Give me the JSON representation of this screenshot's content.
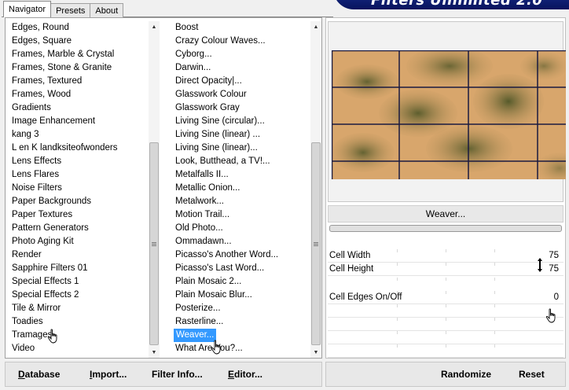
{
  "tabs": [
    {
      "label": "Navigator",
      "active": true
    },
    {
      "label": "Presets",
      "active": false
    },
    {
      "label": "About",
      "active": false
    }
  ],
  "banner": {
    "title": "Filters Unlimited 2.0"
  },
  "categories": [
    "Edges, Round",
    "Edges, Square",
    "Frames, Marble & Crystal",
    "Frames, Stone & Granite",
    "Frames, Textured",
    "Frames, Wood",
    "Gradients",
    "Image Enhancement",
    "kang 3",
    "L en K landksiteofwonders",
    "Lens Effects",
    "Lens Flares",
    "Noise Filters",
    "Paper Backgrounds",
    "Paper Textures",
    "Pattern Generators",
    "Photo Aging Kit",
    "Render",
    "Sapphire Filters 01",
    "Special Effects 1",
    "Special Effects 2",
    "Tile & Mirror",
    "Toadies",
    "Tramages",
    "Video"
  ],
  "filters": [
    "Boost",
    "Crazy Colour Waves...",
    "Cyborg...",
    "Darwin...",
    "Direct Opacity|...",
    "Glasswork Colour",
    "Glasswork Gray",
    "Living Sine (circular)...",
    "Living Sine (linear) ...",
    "Living Sine (linear)...",
    "Look, Butthead, a TV!...",
    "Metalfalls II...",
    "Metallic Onion...",
    "Metalwork...",
    "Motion Trail...",
    "Old Photo...",
    "Ommadawn...",
    "Picasso's Another Word...",
    "Picasso's Last Word...",
    "Plain Mosaic 2...",
    "Plain Mosaic Blur...",
    "Posterize...",
    "Rasterline...",
    "Weaver...",
    "What Are You?..."
  ],
  "selected_filter": "Weaver...",
  "filter_title": "Weaver...",
  "params": [
    {
      "label": "Cell Width",
      "value": "75"
    },
    {
      "label": "Cell Height",
      "value": "75"
    },
    {
      "label": "Cell Edges On/Off",
      "value": "0"
    }
  ],
  "buttons_left": [
    {
      "label": "Database",
      "underline": "D",
      "rest": "atabase"
    },
    {
      "label": "Import...",
      "underline": "I",
      "rest": "mport..."
    },
    {
      "label": "Filter Info...",
      "underline": "",
      "rest": "Filter Info..."
    },
    {
      "label": "Editor...",
      "underline": "E",
      "rest": "ditor..."
    }
  ],
  "buttons_right": [
    {
      "label": "Randomize"
    },
    {
      "label": "Reset"
    }
  ],
  "colors": {
    "selection": "#3399ff",
    "banner": "#0b1a6e",
    "tile_light": "#d8a66c",
    "tile_dark": "#4f5627",
    "tile_border": "#1a1a40"
  },
  "icons": {
    "cursor": "hand-pointer-icon",
    "link": "link-arrows-icon",
    "scroll_up": "triangle-up-icon",
    "scroll_down": "triangle-down-icon"
  }
}
